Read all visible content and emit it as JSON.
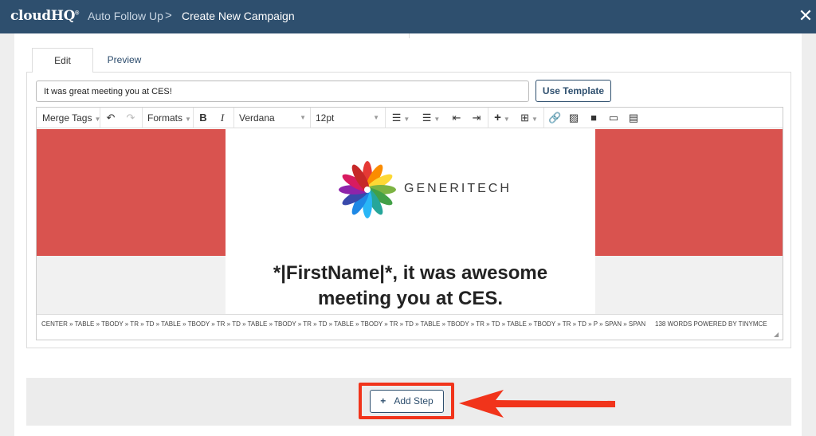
{
  "header": {
    "logo": "cloudHQ",
    "logo_mark": "®",
    "breadcrumb": [
      "Auto Follow Up",
      "Create New Campaign"
    ],
    "breadcrumb_separator": ">",
    "close_icon": "close-icon"
  },
  "tabs": [
    {
      "label": "Edit",
      "active": true
    },
    {
      "label": "Preview",
      "active": false
    }
  ],
  "subject": {
    "value": "It was great meeting you at CES!"
  },
  "use_template_label": "Use Template",
  "toolbar": {
    "merge_tags": "Merge Tags",
    "formats": "Formats",
    "bold": "B",
    "italic": "I",
    "font": "Verdana",
    "size": "12pt"
  },
  "email": {
    "brand": "GENERITECH",
    "headline_line1": "*|FirstName|*, it was awesome",
    "headline_line2": "meeting you at CES.",
    "accent_color": "#d9534f"
  },
  "statusbar": {
    "path": "CENTER » TABLE » TBODY » TR » TD » TABLE » TBODY » TR » TD » TABLE » TBODY » TR » TD » TABLE » TBODY » TR » TD » TABLE » TBODY » TR » TD » TABLE » TBODY » TR » TD » P » SPAN » SPAN",
    "words": "138 WORDS POWERED BY TINYMCE"
  },
  "add_step": {
    "plus": "+",
    "label": "Add Step",
    "highlight_color": "#f1341b"
  }
}
